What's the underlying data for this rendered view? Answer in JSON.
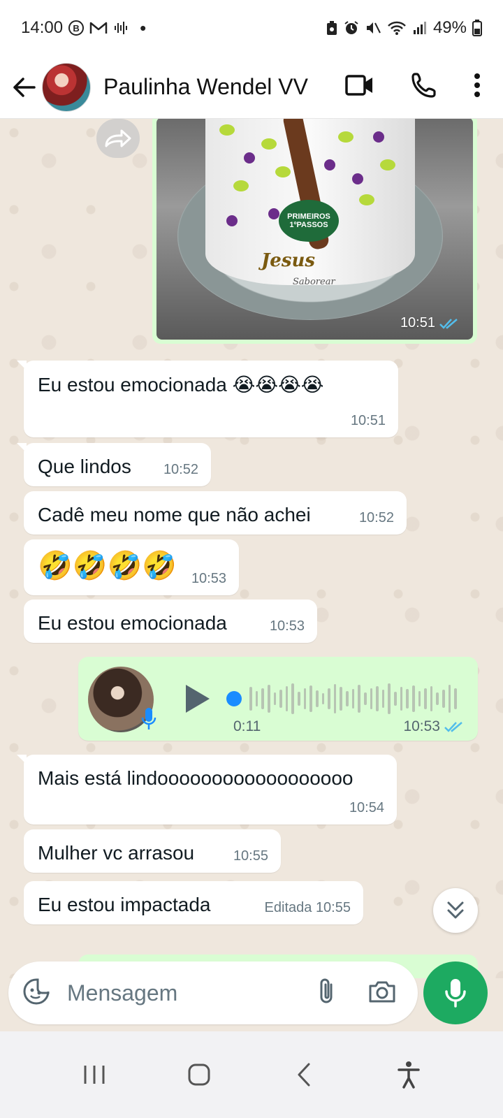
{
  "status_bar": {
    "time": "14:00",
    "battery": "49%",
    "left_icons": [
      "b-circle-icon",
      "gmail-icon",
      "voicemail-icon",
      "dot-icon"
    ],
    "right_icons": [
      "battery-saver-icon",
      "alarm-icon",
      "mute-icon",
      "wifi-icon",
      "signal-icon",
      "battery-icon"
    ]
  },
  "header": {
    "contact_name": "Paulinha Wendel VV",
    "icons": [
      "back-arrow-icon",
      "video-call-icon",
      "phone-icon",
      "more-vert-icon"
    ]
  },
  "chat": {
    "image_message": {
      "time": "10:51",
      "status": "read",
      "cake_badge": "PRIMEIROS 1ºPASSOS",
      "cake_script": "Jesus",
      "cake_brand": "Saborear"
    },
    "messages": [
      {
        "text": "Eu estou emocionada 😭😭😭😭",
        "time": "10:51"
      },
      {
        "text": "Que lindos",
        "time": "10:52"
      },
      {
        "text": "Cadê meu nome que não achei",
        "time": "10:52"
      },
      {
        "text": "🤣🤣🤣🤣",
        "time": "10:53"
      },
      {
        "text": "Eu estou emocionada",
        "time": "10:53"
      }
    ],
    "voice_message": {
      "duration": "0:11",
      "time": "10:53",
      "status": "read",
      "progress": 0.0
    },
    "messages_after": [
      {
        "text": "Mais está lindoooooooooooooooooo",
        "time": "10:54"
      },
      {
        "text": "Mulher vc arrasou",
        "time": "10:55"
      },
      {
        "text": "Eu estou impactada",
        "edited_label": "Editada",
        "time": "10:55"
      }
    ]
  },
  "composer": {
    "placeholder": "Mensagem",
    "icons": [
      "sticker-icon",
      "attach-icon",
      "camera-icon",
      "mic-icon"
    ]
  },
  "nav_bar": {
    "icons": [
      "recent-apps-icon",
      "home-icon",
      "back-icon",
      "accessibility-icon"
    ]
  },
  "colors": {
    "outgoing_bubble": "#d9fdd3",
    "incoming_bubble": "#ffffff",
    "accent_green": "#1daa61",
    "read_tick": "#53bdeb",
    "chat_background": "#efe7dd"
  }
}
